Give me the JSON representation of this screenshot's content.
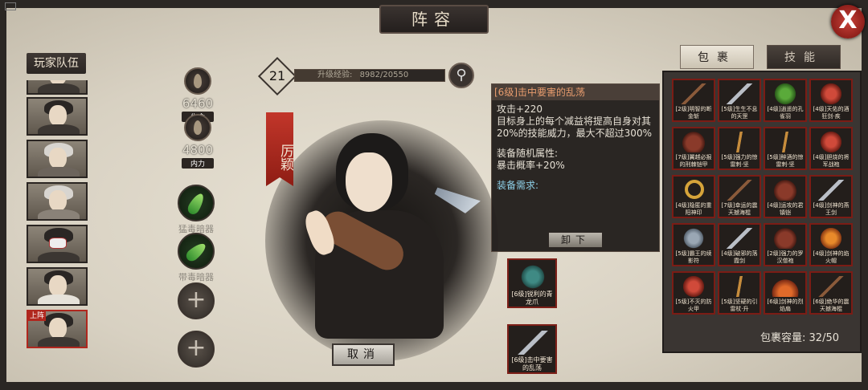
{
  "header": {
    "title": "阵容",
    "close_label": "X"
  },
  "roster": {
    "title": "玩家队伍",
    "deploy_tag": "上阵",
    "portraits": [
      "hero-young",
      "hero-white-hair",
      "hero-elder",
      "hero-mask",
      "hero-scholar",
      "hero-active"
    ]
  },
  "stats": {
    "hp": {
      "value": "6460",
      "label": "生命"
    },
    "mp": {
      "value": "4800",
      "label": "内力"
    }
  },
  "skills": [
    {
      "name": "猛毒暗器",
      "icon": "poison-dart-icon"
    },
    {
      "name": "带毒暗器",
      "icon": "poison-blade-icon"
    }
  ],
  "add_slot_label": "+",
  "level": {
    "value": "21",
    "exp_label": "升级经验:",
    "exp_value": "8982/20550",
    "exp_fraction": 0.437
  },
  "character": {
    "name": "厉颖"
  },
  "cancel_label": "取消",
  "tooltip": {
    "title": "[6级]击中要害的乱荡",
    "attack": "攻击+220",
    "desc": "目标身上的每个减益将提高自身对其20%的技能威力，最大不超过300%",
    "random_attr_title": "装备随机属性:",
    "random_attr": "暴击概率+20%",
    "requirement": "装备需求:",
    "unequip_label": "卸下"
  },
  "equipped": [
    {
      "caption": "[6级]锐利的青龙爪",
      "icon": "glove-icon"
    },
    {
      "caption": "[6级]击中要害的乱荡",
      "icon": "sword-icon"
    }
  ],
  "bag": {
    "tabs": [
      "包裹",
      "技能"
    ],
    "capacity_label": "包裹容量:",
    "capacity": "32/50",
    "items": [
      {
        "caption": "[2级]明智的断金斩",
        "icon": "stick"
      },
      {
        "caption": "[5级]生生不息的天罡",
        "icon": "sword"
      },
      {
        "caption": "[4级]逍遥的孔雀羽",
        "icon": "feather"
      },
      {
        "caption": "[4级]天佑的酒狂剑·疾",
        "icon": "red"
      },
      {
        "caption": "[7级]翼越必报的刑棘铠甲",
        "icon": "armor"
      },
      {
        "caption": "[5级]强力的惊雷刺·坚",
        "icon": "hook"
      },
      {
        "caption": "[5级]醉酒的惊雷刺·坚",
        "icon": "hook"
      },
      {
        "caption": "[4级]胆烧的将军战袍",
        "icon": "red"
      },
      {
        "caption": "[4级]隐匿的重阳神印",
        "icon": "ring"
      },
      {
        "caption": "[7级]幸运的震天撼海棍",
        "icon": "stick"
      },
      {
        "caption": "[4级]运攻的君镇铠",
        "icon": "armor"
      },
      {
        "caption": "[4级]剑神的燕王剑",
        "icon": "sword"
      },
      {
        "caption": "[5级]霸王的续影符",
        "icon": "boot"
      },
      {
        "caption": "[4级]破邪的落霞剑",
        "icon": "sword"
      },
      {
        "caption": "[2级]强力的罗汉僧袍",
        "icon": "armor"
      },
      {
        "caption": "[4级]剑神的焰火帽",
        "icon": "orange"
      },
      {
        "caption": "[5级]不灭的防火甲",
        "icon": "red"
      },
      {
        "caption": "[5级]坚硬的引雷杖·升",
        "icon": "hook"
      },
      {
        "caption": "[6级]剑神的烈焰扇",
        "icon": "fan"
      },
      {
        "caption": "[6级]绝华的震天撼海棍",
        "icon": "stick"
      }
    ]
  }
}
